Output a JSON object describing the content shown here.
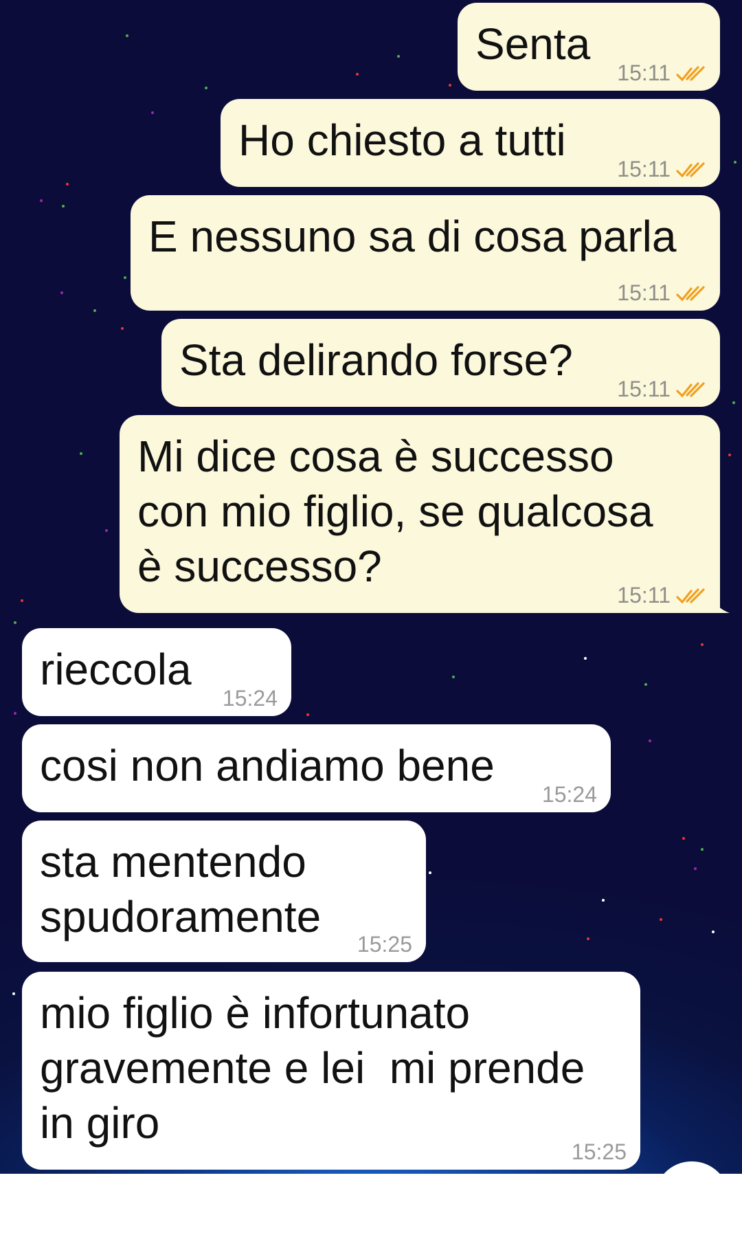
{
  "colors": {
    "outgoing_bubble": "#fcf8dc",
    "incoming_bubble": "#ffffff",
    "read_ticks": "#f0a020",
    "time_text": "#8e8e88",
    "wallpaper": "#0b0c3a"
  },
  "messages": [
    {
      "direction": "outgoing",
      "text": "Senta",
      "time": "15:11",
      "status_icon": "double-check-read-icon"
    },
    {
      "direction": "outgoing",
      "text": "Ho chiesto a tutti",
      "time": "15:11",
      "status_icon": "double-check-read-icon"
    },
    {
      "direction": "outgoing",
      "text": "E nessuno sa di cosa parla",
      "time": "15:11",
      "status_icon": "double-check-read-icon"
    },
    {
      "direction": "outgoing",
      "text": "Sta delirando forse?",
      "time": "15:11",
      "status_icon": "double-check-read-icon"
    },
    {
      "direction": "outgoing",
      "text": "Mi dice cosa è successo\ncon mio figlio, se qualcosa\nè successo?",
      "time": "15:11",
      "status_icon": "double-check-read-icon"
    },
    {
      "direction": "incoming",
      "text": "rieccola",
      "time": "15:24"
    },
    {
      "direction": "incoming",
      "text": "cosi non andiamo bene",
      "time": "15:24"
    },
    {
      "direction": "incoming",
      "text": "sta mentendo\nspudoramente",
      "time": "15:25"
    },
    {
      "direction": "incoming",
      "text": "mio figlio è infortunato\ngravemente e lei  mi prende\nin giro",
      "time": "15:25"
    }
  ]
}
